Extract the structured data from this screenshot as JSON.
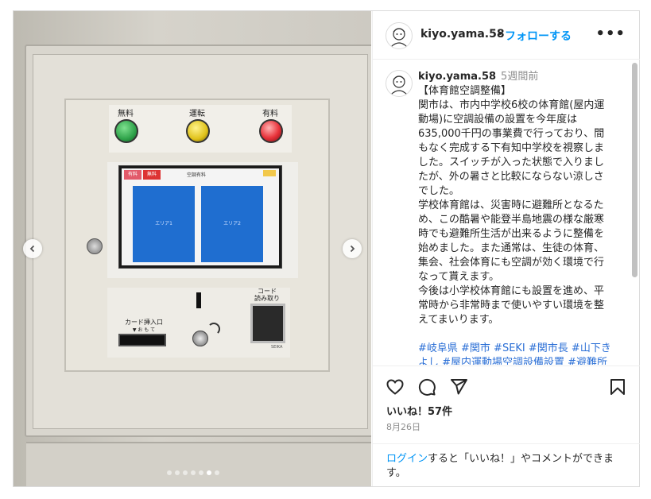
{
  "account": {
    "username": "kiyo.yama.58",
    "separator": "•",
    "follow_label": "フォローする",
    "more_label": "•••"
  },
  "photo": {
    "lamps": [
      {
        "label": "無料",
        "color": "#2fa34a"
      },
      {
        "label": "運転",
        "color": "#e0c21a"
      },
      {
        "label": "有料",
        "color": "#e8323a"
      }
    ],
    "screen": {
      "btn1": "有料",
      "btn2": "無料",
      "title": "空調有料",
      "area1": "エリア1",
      "area2": "エリア2"
    },
    "card_slot_label": "カード挿入口",
    "card_slot_sub": "▼ お も て",
    "code_reader_label": "コード\n読み取り",
    "brand": "SEIKA",
    "carousel": {
      "count": 7,
      "active_index": 5
    }
  },
  "caption": {
    "username": "kiyo.yama.58",
    "time": "5週間前",
    "body": "【体育館空調整備】\n関市は、市内中学校6校の体育館(屋内運動場)に空調設備の設置を今年度は635,000千円の事業費で行っており、間もなく完成する下有知中学校を視察しました。スイッチが入った状態で入りましたが、外の暑さと比較にならない涼しさでした。\n学校体育館は、災害時に避難所となるため、この酷暑や能登半島地震の様な厳寒時でも避難所生活が出来るように整備を始めました。また通常は、生徒の体育、集会、社会体育にも空調が効く環境で行なって貰えます。\n今後は小学校体育館にも設置を進め、平常時から非常時まで使いやすい環境を整えてまいります。",
    "hashtags": "#岐阜県 #関市 #SEKI #関市長 #山下きよし #屋内運動場空調設備設置 #避難所施設空調設備設置"
  },
  "actions": {
    "likes": "いいね！57件",
    "date": "8月26日",
    "login_link": "ログイン",
    "login_text": "すると「いいね！」やコメントができます。"
  },
  "icons": [
    "heart-icon",
    "comment-icon",
    "share-icon",
    "bookmark-icon",
    "chevron-left-icon",
    "chevron-right-icon"
  ]
}
